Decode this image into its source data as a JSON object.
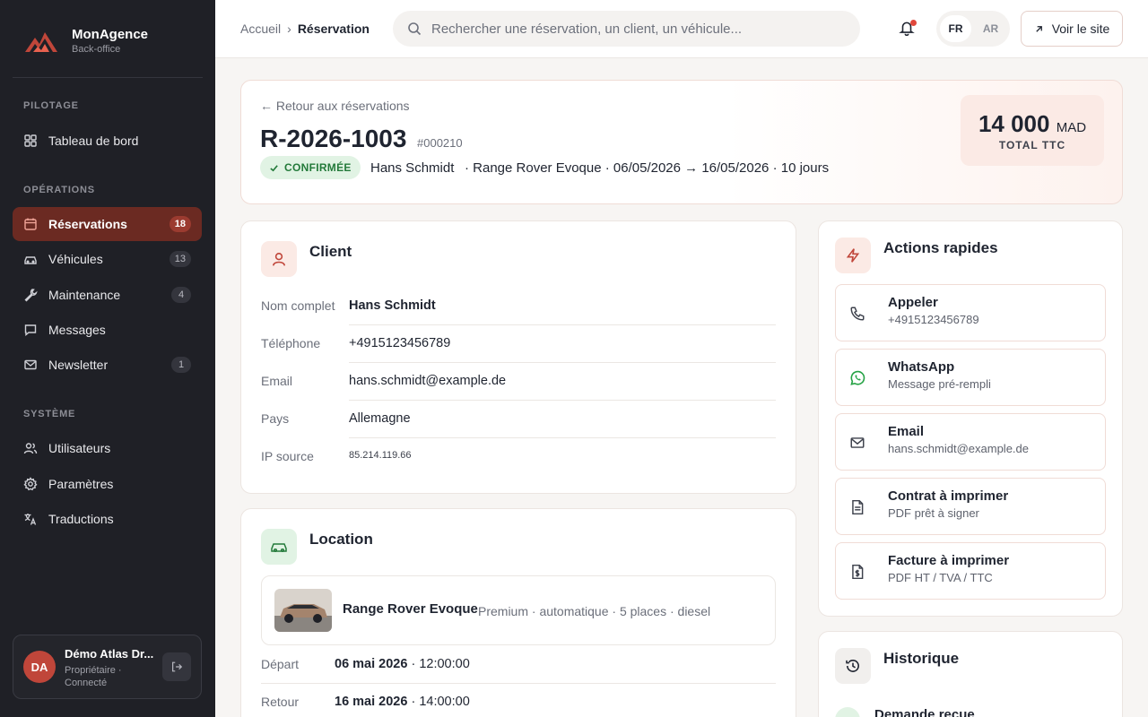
{
  "brand": {
    "name": "MonAgence",
    "subtitle": "Back-office"
  },
  "sidebar": {
    "sections": [
      {
        "label": "PILOTAGE"
      },
      {
        "label": "OPÉRATIONS"
      },
      {
        "label": "SYSTÈME"
      }
    ],
    "items": [
      {
        "label": "Tableau de bord",
        "icon": "grid-icon"
      },
      {
        "label": "Réservations",
        "icon": "calendar-icon",
        "badge": "18",
        "active": true
      },
      {
        "label": "Véhicules",
        "icon": "car-icon",
        "badge": "13"
      },
      {
        "label": "Maintenance",
        "icon": "wrench-icon",
        "badge": "4"
      },
      {
        "label": "Messages",
        "icon": "message-icon"
      },
      {
        "label": "Newsletter",
        "icon": "mail-icon",
        "badge": "1"
      },
      {
        "label": "Utilisateurs",
        "icon": "users-icon"
      },
      {
        "label": "Paramètres",
        "icon": "gear-icon"
      },
      {
        "label": "Traductions",
        "icon": "translate-icon"
      }
    ],
    "user": {
      "initials": "DA",
      "name": "Démo Atlas Dr...",
      "role": "Propriétaire · Connecté"
    }
  },
  "header": {
    "breadcrumb": [
      "Accueil",
      "›",
      "Réservation"
    ],
    "search_placeholder": "Rechercher une réservation, un client, un véhicule...",
    "languages": [
      "FR",
      "AR"
    ],
    "active_language": "FR",
    "site_button": "Voir le site"
  },
  "reservation": {
    "back_label": "← Retour aux réservations",
    "id": "R-2026-1003",
    "number": "#000210",
    "status": "CONFIRMÉE",
    "client_name": "Hans Schmidt",
    "details": "· Range Rover Evoque · 06/05/2026 → 16/05/2026 · 10 jours",
    "total_amount": "14 000",
    "total_currency": "MAD",
    "total_label": "TOTAL TTC"
  },
  "client_card": {
    "title": "Client",
    "fields": [
      {
        "label": "Nom complet",
        "value": "Hans Schmidt"
      },
      {
        "label": "Téléphone",
        "value": "+4915123456789"
      },
      {
        "label": "Email",
        "value": "hans.schmidt@example.de"
      },
      {
        "label": "Pays",
        "value": "Allemagne"
      },
      {
        "label": "IP source",
        "value": "85.214.119.66"
      }
    ]
  },
  "location_card": {
    "title": "Location",
    "car_name": "Range Rover Evoque",
    "car_meta": "Premium · automatique · 5 places · diesel",
    "departure_label": "Départ",
    "departure_date": "06 mai 2026",
    "departure_time": "· 12:00:00",
    "return_label": "Retour",
    "return_date": "16 mai 2026",
    "return_time": "· 14:00:00"
  },
  "actions_card": {
    "title": "Actions rapides",
    "actions": [
      {
        "title": "Appeler",
        "subtitle": "+4915123456789",
        "icon": "phone-icon"
      },
      {
        "title": "WhatsApp",
        "subtitle": "Message pré-rempli",
        "icon": "whatsapp-icon"
      },
      {
        "title": "Email",
        "subtitle": "hans.schmidt@example.de",
        "icon": "mail-icon"
      },
      {
        "title": "Contrat à imprimer",
        "subtitle": "PDF prêt à signer",
        "icon": "document-icon"
      },
      {
        "title": "Facture à imprimer",
        "subtitle": "PDF HT / TVA / TTC",
        "icon": "invoice-icon"
      }
    ]
  },
  "history_card": {
    "title": "Historique",
    "first_event": "Demande reçue"
  },
  "colors": {
    "sidebar_bg": "#1f2026",
    "accent": "#c0463a",
    "active_nav": "#6b2a22",
    "success": "#237a3a"
  }
}
